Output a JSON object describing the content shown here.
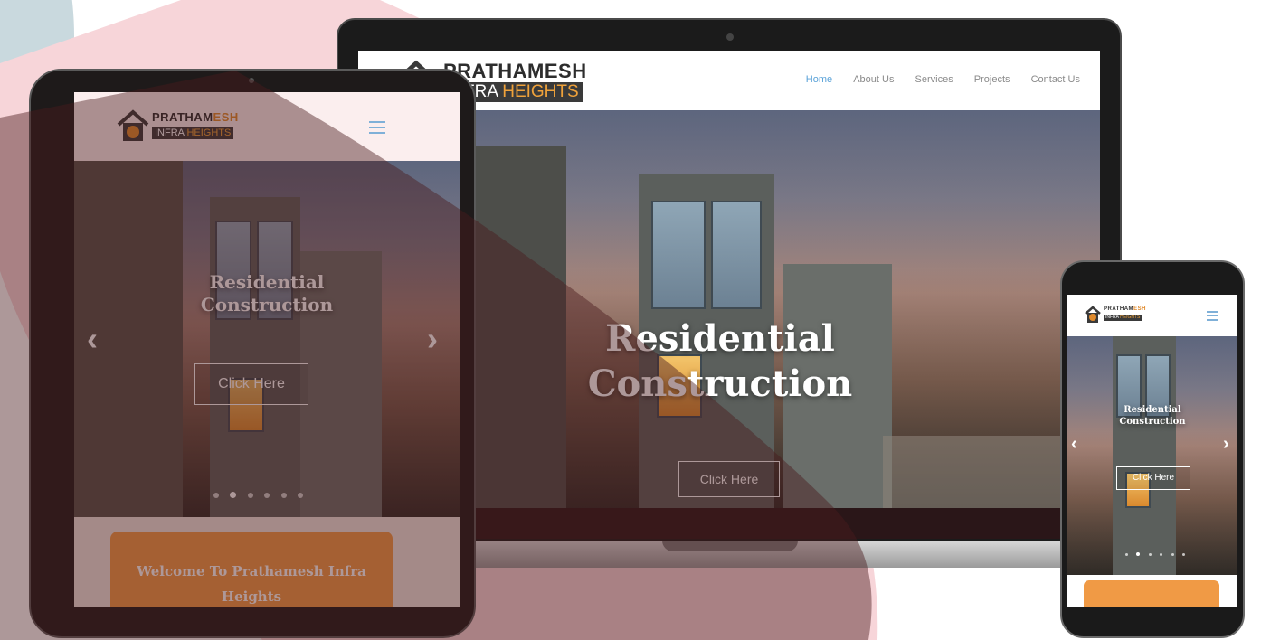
{
  "brand": {
    "name_part1": "PRATHAM",
    "name_part2": "ESH",
    "sub_part1": "INFRA",
    "sub_part2": "HEIGHTS",
    "laptop_name": "PRATHAMESH",
    "laptop_sub_part1": "INFRA",
    "laptop_sub_part2": "HEIGHTS"
  },
  "nav": {
    "items": [
      {
        "label": "Home",
        "active": true
      },
      {
        "label": "About Us"
      },
      {
        "label": "Services"
      },
      {
        "label": "Projects"
      },
      {
        "label": "Contact Us"
      }
    ]
  },
  "hero": {
    "title_line1": "Residential",
    "title_line2": "Construction",
    "cta_label": "Click Here",
    "prev_arrow": "‹",
    "next_arrow": "›",
    "slide_count": 6,
    "active_slide": 2
  },
  "welcome": {
    "title_line1": "Welcome To Prathamesh Infra",
    "title_line2": "Heights"
  },
  "icons": {
    "hamburger": "menu-icon",
    "logo": "house-logo-icon"
  },
  "colors": {
    "accent_blue": "#5aa2d8",
    "brand_orange": "#e08a2c",
    "welcome_orange": "#f09a45",
    "bg_pink": "#f5cdd2",
    "bg_slate": "#bcd0d8",
    "overlay_maroon": "#4a1a1d"
  }
}
